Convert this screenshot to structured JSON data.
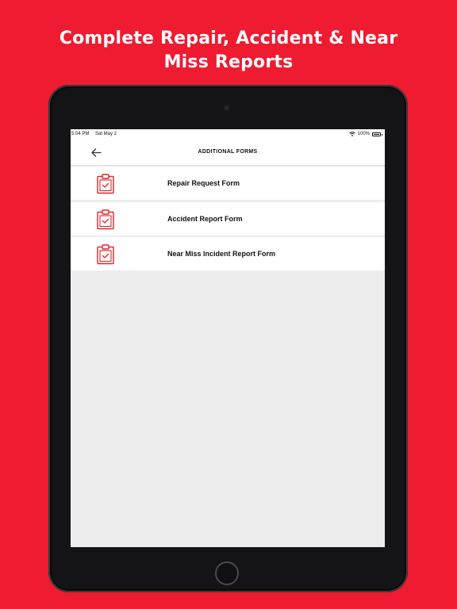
{
  "headline": {
    "line1": "Complete Repair, Accident & Near",
    "line2": "Miss Reports"
  },
  "status_bar": {
    "time": "5:04 PM",
    "date": "Sat May 2",
    "battery": "100%"
  },
  "nav": {
    "back_icon": "arrow-left-icon",
    "title": "ADDITIONAL FORMS"
  },
  "forms": [
    {
      "label": "Repair Request Form",
      "icon": "clipboard-check-icon"
    },
    {
      "label": "Accident Report Form",
      "icon": "clipboard-check-icon"
    },
    {
      "label": "Near Miss Incident Report Form",
      "icon": "clipboard-check-icon"
    }
  ],
  "colors": {
    "brand_red": "#EE1B31",
    "icon_red": "#E0252E",
    "device": "#141416",
    "screen_bg": "#EDEDED"
  }
}
